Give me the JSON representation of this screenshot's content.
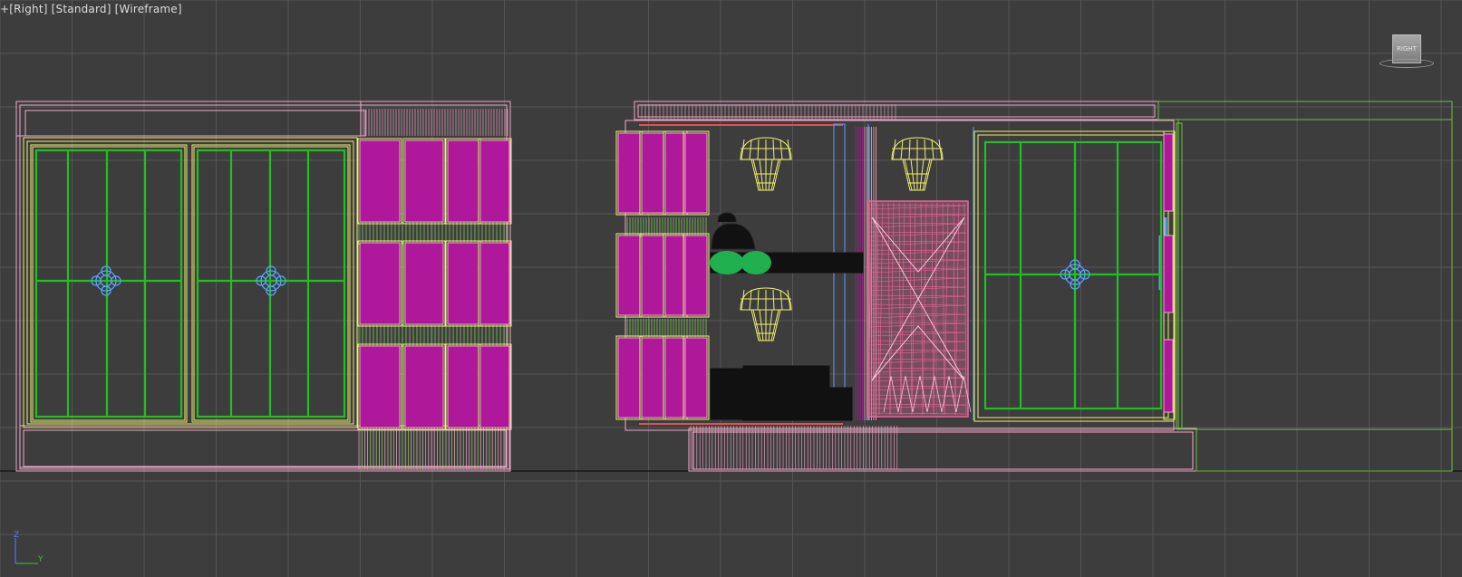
{
  "viewport": {
    "label_plus": "+",
    "label_view": "[Right]",
    "label_shading": "[Standard]",
    "label_mode": "[Wireframe]",
    "viewcube_face": "RIGHT",
    "axis_z": "Z",
    "axis_y": "Y"
  },
  "colors": {
    "background": "#3d3d3d",
    "grid": "#555555",
    "pink": "#f0a8c8",
    "magenta": "#b0189c",
    "green": "#20c020",
    "yellow": "#f0f070",
    "blue": "#5aa0ff",
    "hot_pink": "#e8689c",
    "lime": "#6cc040",
    "light_green": "#8ad860"
  }
}
